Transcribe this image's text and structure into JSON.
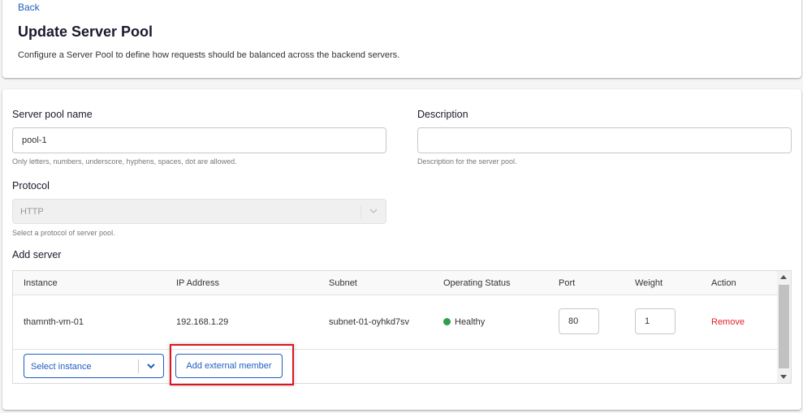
{
  "header": {
    "back_label": "Back",
    "title": "Update Server Pool",
    "subtitle": "Configure a Server Pool to define how requests should be balanced across the backend servers."
  },
  "form": {
    "pool_name": {
      "label": "Server pool name",
      "value": "pool-1",
      "helper": "Only letters, numbers, underscore, hyphens, spaces, dot are allowed."
    },
    "description": {
      "label": "Description",
      "value": "",
      "helper": "Description for the server pool."
    },
    "protocol": {
      "label": "Protocol",
      "value": "HTTP",
      "helper": "Select a protocol of server pool.",
      "disabled": true
    },
    "add_server": {
      "label": "Add server",
      "columns": [
        "Instance",
        "IP Address",
        "Subnet",
        "Operating Status",
        "Port",
        "Weight",
        "Action"
      ],
      "rows": [
        {
          "instance": "thamnth-vm-01",
          "ip": "192.168.1.29",
          "subnet": "subnet-01-oyhkd7sv",
          "status": "Healthy",
          "status_color": "#2e9e47",
          "port": "80",
          "weight": "1",
          "action": "Remove"
        }
      ],
      "select_instance_placeholder": "Select instance",
      "add_external_label": "Add external member"
    }
  },
  "colors": {
    "accent": "#1f5fbf",
    "danger": "#e8202a",
    "highlight": "#e0141e"
  }
}
